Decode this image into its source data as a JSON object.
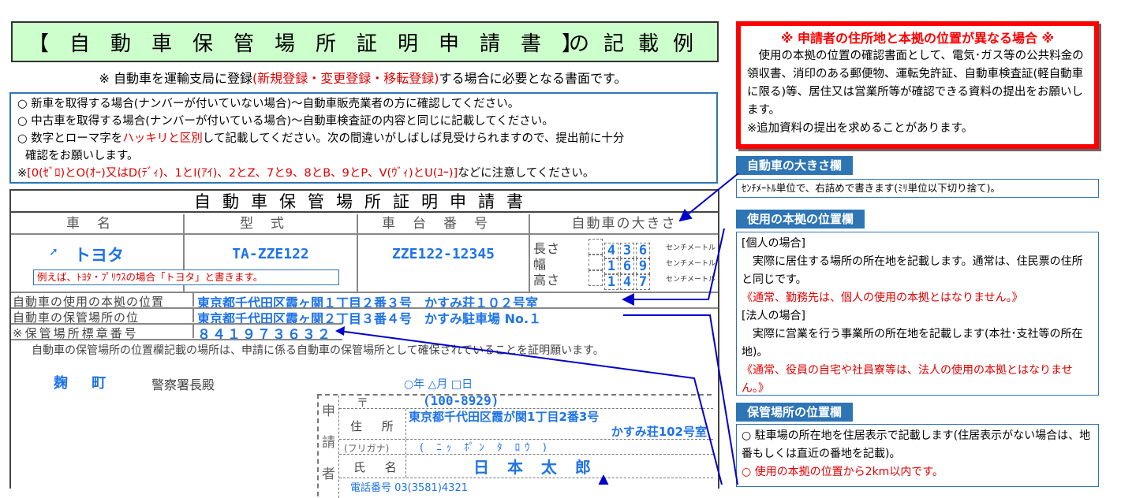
{
  "title": {
    "main": "【自動車保管場所証明申請書】",
    "suffix": "の記載例"
  },
  "subtitle": {
    "pre": "※ 自動車を運輸支局に登録",
    "red": "(新規登録・変更登録・移転登録)",
    "post": "する場合に必要となる書面です。"
  },
  "notes": {
    "line1": "○ 新車を取得する場合(ナンバーが付いていない場合)～自動車販売業者の方に確認してください。",
    "line2": "○ 中古車を取得する場合(ナンバーが付いている場合)～自動車検査証の内容と同じに記載してください。",
    "line3_pre": "○ 数字とローマ字を",
    "line3_red": "ハッキリと区別",
    "line3_post": "して記載してください。次の間違いがしばしば見受けられますので、提出前に十分",
    "line4": "確認をお願いします。",
    "line5_pre": "※",
    "line5_red": "[0(ｾﾞﾛ)とO(ｵｰ)又はD(ﾃﾞｨ)、1とI(ｱｲ)、2とZ、7と9、8とB、9とP、V(ｳﾞｨ)とU(ﾕｰ)]",
    "line5_post": "などに注意してください。"
  },
  "form": {
    "title": "自動車保管場所証明申請書",
    "headers": {
      "name": "車名",
      "model": "型式",
      "chassis": "車台番号",
      "size": "自動車の大きさ"
    },
    "car_name": "トヨタ",
    "model": "TA-ZZE122",
    "chassis": "ZZE122-12345",
    "size_labels": {
      "length": "長さ",
      "width": "幅",
      "height": "高さ"
    },
    "size_unit": "センチメートル",
    "length_digits": [
      "",
      "4",
      "3",
      "6"
    ],
    "width_digits": [
      "",
      "1",
      "6",
      "9"
    ],
    "height_digits": [
      "",
      "1",
      "4",
      "7"
    ],
    "example_note": "例えば、ﾄﾖﾀ・ﾌﾟﾘｳｽの場合「トヨタ」と書きます。",
    "use_base_label": "自動車の使用の本拠の位置",
    "use_base_value": "東京都千代田区霞ヶ関１丁目２番３号　かすみ荘１０２号室",
    "storage_label": "自動車の保管場所の位",
    "storage_value": "東京都千代田区霞ヶ関２丁目３番４号　かすみ駐車場 No.１",
    "sticker_label": "※保管場所標章番号",
    "sticker_value": "８４１９７３６３２",
    "certify_text": "自動車の保管場所の位置欄記載の場所は、申請に係る自動車の保管場所として確保されていることを証明願います。",
    "police_name": "麹 町",
    "police_suffix": "警察署長殿",
    "date_line": "○年 △月 □日",
    "applicant_vertical": [
      "申",
      "請",
      "者"
    ],
    "postal_label": "〒",
    "postal_value": "(100-8929)",
    "address_label": "住 所",
    "address_line1": "東京都千代田区霞が関1丁目2番3号",
    "address_line2": "かすみ荘102号室",
    "furigana_label": "(フリガナ)",
    "furigana_value": "( ﾆｯ ﾎﾟﾝ ﾀ ﾛｳ )",
    "name_label": "氏 名",
    "name_value": "日 本 太 郎",
    "phone_partial": "電話番号 03(3581)4321"
  },
  "warning": {
    "head": "※ 申請者の住所地と本拠の位置が異なる場合 ※",
    "body": "使用の本拠の位置の確認書面として、電気･ガス等の公共料金の領収書、消印のある郵便物、運転免許証、自動車検査証(軽自動車に限る)等、居住又は営業所等が確認できる資料の提出をお願いします。",
    "extra": "※追加資料の提出を求めることがあります。"
  },
  "size_section": {
    "tag": "自動車の大きさ欄",
    "text": "ｾﾝﾁﾒｰﾄﾙ単位で、右詰めで書きます(ﾐﾘ単位以下切り捨て)。"
  },
  "base_section": {
    "tag": "使用の本拠の位置欄",
    "individual_head": "[個人の場合]",
    "individual_text": "実際に居住する場所の所在地を記載します。通常は、住民票の住所と同じです。",
    "individual_red": "《通常、勤務先は、個人の使用の本拠とはなりません。》",
    "corporate_head": "[法人の場合]",
    "corporate_text": "実際に営業を行う事業所の所在地を記載します(本社･支社等の所在地)。",
    "corporate_red": "《通常、役員の自宅や社員寮等は、法人の使用の本拠とはなりません。》"
  },
  "storage_section": {
    "tag": "保管場所の位置欄",
    "item1": "○ 駐車場の所在地を住居表示で記載します(住居表示がない場合は、地番もしくは直近の番地を記載)。",
    "item2": "○ 使用の本拠の位置から2km以内です。"
  },
  "colors": {
    "accent": "#2e75b6",
    "ink": "#1e73e6",
    "warn": "#ff0000",
    "title_bg": "#ccffcc"
  }
}
